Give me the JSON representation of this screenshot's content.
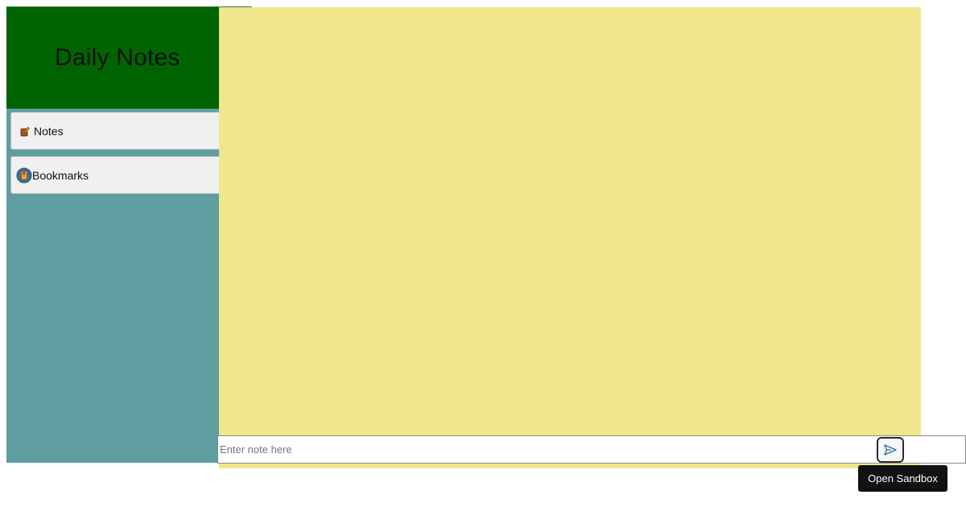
{
  "app": {
    "title": "Daily Notes"
  },
  "sidebar": {
    "items": [
      {
        "label": "Notes",
        "icon": "pencil-note-icon"
      },
      {
        "label": "Bookmarks",
        "icon": "bookmark-icon"
      }
    ]
  },
  "composer": {
    "placeholder": "Enter note here",
    "value": "",
    "send_icon": "send-icon"
  },
  "tooltip": {
    "label": "Open Sandbox"
  },
  "colors": {
    "sidebar_bg": "#5f9ea0",
    "header_bg": "#006400",
    "main_bg": "#f0e68c",
    "nav_item_bg": "#f0f0f0",
    "tooltip_bg": "#121212"
  }
}
